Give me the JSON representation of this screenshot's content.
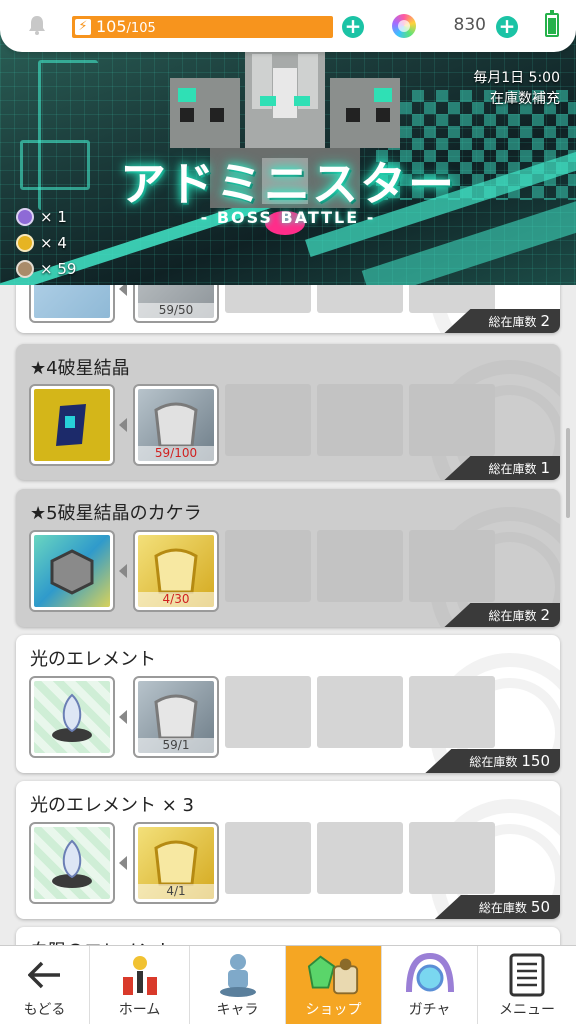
{
  "status_bar": {
    "stamina_current": "105",
    "stamina_max": "/105",
    "gem_count": "830"
  },
  "banner": {
    "title": "アドミニスター",
    "subtitle": "- BOSS BATTLE -",
    "refill_line1": "毎月1日 5:00",
    "refill_line2": "在庫数補充",
    "medals": [
      {
        "icon": "purple-medal-icon",
        "color": "#8e6ad6",
        "count": "× 1"
      },
      {
        "icon": "gold-medal-icon",
        "color": "#e6b422",
        "count": "× 4"
      },
      {
        "icon": "bronze-medal-icon",
        "color": "#a98b6a",
        "count": "× 59"
      }
    ]
  },
  "shop_items": [
    {
      "title": "",
      "cost_count": "59/50",
      "stock_label": "総在庫数",
      "stock_value": "2",
      "dim": false
    },
    {
      "title": "★4破星結晶",
      "cost_count": "59/100",
      "stock_label": "総在庫数",
      "stock_value": "1",
      "dim": true
    },
    {
      "title": "★5破星結晶のカケラ",
      "cost_count": "4/30",
      "stock_label": "総在庫数",
      "stock_value": "2",
      "dim": true
    },
    {
      "title": "光のエレメント",
      "cost_count": "59/1",
      "stock_label": "総在庫数",
      "stock_value": "150",
      "dim": false
    },
    {
      "title": "光のエレメント × 3",
      "cost_count": "4/1",
      "stock_label": "総在庫数",
      "stock_value": "50",
      "dim": false
    },
    {
      "title": "白限のエレメント",
      "dim": false
    }
  ],
  "nav": {
    "back": "もどる",
    "home": "ホーム",
    "chara": "キャラ",
    "shop": "ショップ",
    "gacha": "ガチャ",
    "menu": "メニュー"
  },
  "colors": {
    "accent_teal": "#1bc3a5",
    "stamina_orange": "#f7941d",
    "nav_active": "#f5a623",
    "stock_tag": "#3a3a3a",
    "insufficient_red": "#d02020"
  }
}
